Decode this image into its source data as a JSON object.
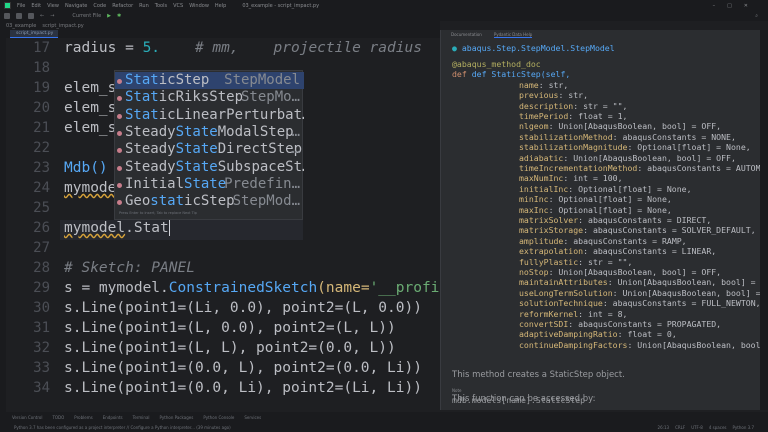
{
  "menu": [
    "File",
    "Edit",
    "View",
    "Navigate",
    "Code",
    "Refactor",
    "Run",
    "Tools",
    "VCS",
    "Window",
    "Help"
  ],
  "window_title": "03_example - script_impact.py",
  "toolbar": {
    "run_config": "Current File"
  },
  "breadcrumb": [
    "03_example",
    "script_impact.py"
  ],
  "editor_tab": "script_impact.py",
  "editor": {
    "line_numbers": [
      "17",
      "18",
      "19",
      "20",
      "21",
      "22",
      "23",
      "24",
      "25",
      "26",
      "27",
      "28",
      "29",
      "30",
      "31",
      "32",
      "33",
      "34"
    ],
    "lines": {
      "l17a": "radius = ",
      "l17b": "5.",
      "l17c": "    # mm,    projectile radius",
      "l19": "elem_si",
      "l20": "elem_si",
      "l21": "elem_si",
      "l23": "Mdb()",
      "l24": "mymodel",
      "l26a": "mymodel",
      ".": ".",
      "l26b": "Stat",
      "l28": "# Sketch: PANEL",
      "l29a": "s = mymodel.",
      "l29b": "ConstrainedSketch",
      "l29c": "(name=",
      "l29d": "'__profile__'",
      ", s": ", s",
      "l30": "s.Line(point1=(Li, 0.0), point2=(L, 0.0))",
      "l31": "s.Line(point1=(L, 0.0), point2=(L, L))",
      "l32": "s.Line(point1=(L, L), point2=(0.0, L))",
      "l33": "s.Line(point1=(0.0, L), point2=(0.0, Li))",
      "l34": "s.Line(point1=(0.0, Li), point2=(Li, Li))"
    }
  },
  "completion": {
    "items": [
      {
        "pre": "",
        "match": "Stat",
        "post": "icStep",
        "type": "StepModel"
      },
      {
        "pre": "",
        "match": "Stat",
        "post": "icRiksStep",
        "type": "StepMo…"
      },
      {
        "pre": "",
        "match": "Stat",
        "post": "icLinearPerturbat…",
        "type": ""
      },
      {
        "pre": "Steady",
        "match": "State",
        "post": "ModalStep",
        "type": "…"
      },
      {
        "pre": "Steady",
        "match": "State",
        "post": "DirectStep",
        "type": "…"
      },
      {
        "pre": "Steady",
        "match": "State",
        "post": "SubspaceSt…",
        "type": ""
      },
      {
        "pre": "Initial",
        "match": "State",
        "post": "",
        "type": "Predefin…"
      },
      {
        "pre": "Geo",
        "match": "stat",
        "post": "icStep",
        "type": "StepMod…"
      }
    ],
    "hint": "Press Enter to insert, Tab to replace  Next Tip"
  },
  "doc_panel": {
    "tabs": [
      "Documentation",
      "Pydantic Data Help"
    ],
    "qualified_name": "abaqus.Step.StepModel.StepModel",
    "decorator": "@abaqus_method_doc",
    "signature_start": "def StaticStep(self,",
    "params": [
      "name: str,",
      "previous: str,",
      "description: str = \"\",",
      "timePeriod: float = 1,",
      "nlgeom: Union[AbaqusBoolean, bool] = OFF,",
      "stabilizationMethod: abaqusConstants = NONE,",
      "stabilizationMagnitude: Optional[float] = None,",
      "adiabatic: Union[AbaqusBoolean, bool] = OFF,",
      "timeIncrementationMethod: abaqusConstants = AUTOMATIC,",
      "maxNumInc: int = 100,",
      "initialInc: Optional[float] = None,",
      "minInc: Optional[float] = None,",
      "maxInc: Optional[float] = None,",
      "matrixSolver: abaqusConstants = DIRECT,",
      "matrixStorage: abaqusConstants = SOLVER_DEFAULT,",
      "amplitude: abaqusConstants = RAMP,",
      "extrapolation: abaqusConstants = LINEAR,",
      "fullyPlastic: str = \"\",",
      "noStop: Union[AbaqusBoolean, bool] = OFF,",
      "maintainAttributes: Union[AbaqusBoolean, bool] = False",
      "useLongTermSolution: Union[AbaqusBoolean, bool] = OFF,",
      "solutionTechnique: abaqusConstants = FULL_NEWTON,",
      "reformKernel: int = 8,",
      "convertSDI: abaqusConstants = PROPAGATED,",
      "adaptiveDampingRatio: float = 0,",
      "continueDampingFactors: Union[AbaqusBoolean, bool] = O"
    ],
    "description": "This method creates a StaticStep object.",
    "note_label": "Note",
    "access_text": "This function can be accessed by:",
    "access_code": "mdb.models[name].StaticStep"
  },
  "bottom_tabs": [
    "Version Control",
    "TODO",
    "Problems",
    "Endpoints",
    "Terminal",
    "Python Packages",
    "Python Console",
    "Services"
  ],
  "status": {
    "message": "Python 3.7 has been configured as a project interpreter // Configure a Python interpreter... (39 minutes ago)",
    "position": "26:13",
    "line_sep": "CRLF",
    "encoding": "UTF-8",
    "indent": "4 spaces",
    "interpreter": "Python 3.7"
  },
  "colors": {
    "accent": "#3574f0",
    "keyword": "#cf8e6d",
    "function": "#56a8f5",
    "number": "#2aacb8",
    "string": "#6aab73"
  }
}
